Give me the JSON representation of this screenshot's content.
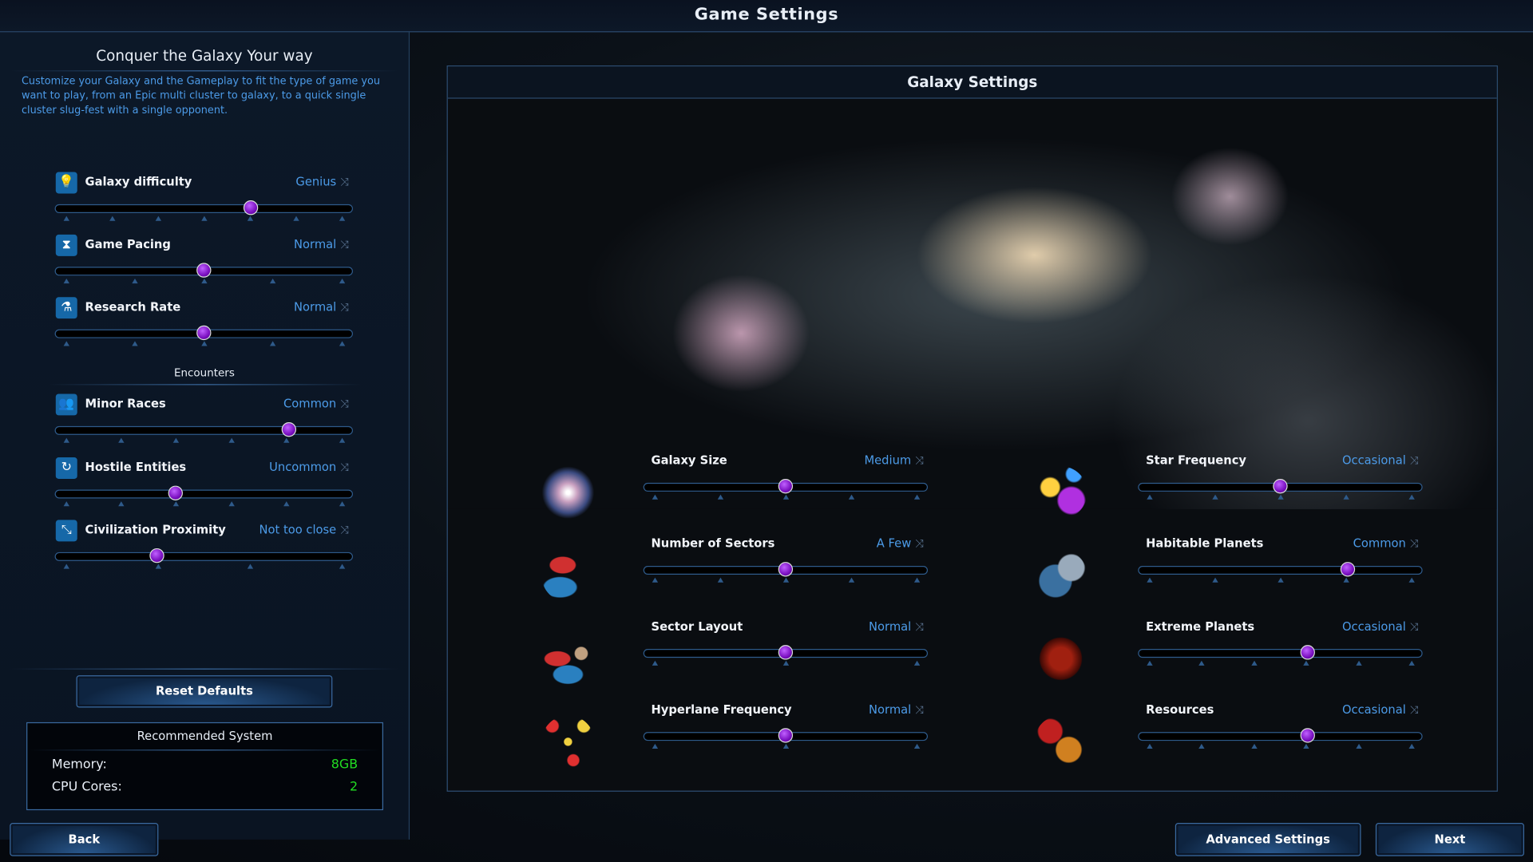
{
  "window_title": "Game Settings",
  "left_panel": {
    "heading": "Conquer the Galaxy Your way",
    "description": "Customize your Galaxy and the Gameplay to fit the type of game you want to play, from an Epic multi cluster to galaxy, to a quick single cluster slug-fest with a single opponent.",
    "encounters_heading": "Encounters",
    "settings": [
      {
        "label": "Galaxy difficulty",
        "value": "Genius",
        "icon": "lightbulb-icon",
        "positions": 7,
        "index": 4
      },
      {
        "label": "Game Pacing",
        "value": "Normal",
        "icon": "hourglass-icon",
        "positions": 5,
        "index": 2
      },
      {
        "label": "Research Rate",
        "value": "Normal",
        "icon": "flask-icon",
        "positions": 5,
        "index": 2
      },
      {
        "label": "Minor Races",
        "value": "Common",
        "icon": "people-icon",
        "positions": 6,
        "index": 4
      },
      {
        "label": "Hostile Entities",
        "value": "Uncommon",
        "icon": "creature-icon",
        "positions": 6,
        "index": 2
      },
      {
        "label": "Civilization Proximity",
        "value": "Not too close",
        "icon": "proximity-icon",
        "positions": 4,
        "index": 1
      }
    ],
    "reset_label": "Reset Defaults",
    "recommended": {
      "heading": "Recommended System",
      "memory_label": "Memory:",
      "memory_value": "8GB",
      "cpu_label": "CPU Cores:",
      "cpu_value": "2"
    }
  },
  "galaxy_settings": {
    "heading": "Galaxy Settings",
    "left_column": [
      {
        "label": "Galaxy Size",
        "value": "Medium",
        "icon": "spiral-galaxy-icon",
        "positions": 5,
        "index": 2
      },
      {
        "label": "Number of Sectors",
        "value": "A Few",
        "icon": "sectors-icon",
        "positions": 5,
        "index": 2
      },
      {
        "label": "Sector Layout",
        "value": "Normal",
        "icon": "sector-layout-icon",
        "positions": 3,
        "index": 1
      },
      {
        "label": "Hyperlane Frequency",
        "value": "Normal",
        "icon": "hyperlane-icon",
        "positions": 3,
        "index": 1
      }
    ],
    "right_column": [
      {
        "label": "Star Frequency",
        "value": "Occasional",
        "icon": "stars-icon",
        "positions": 5,
        "index": 2
      },
      {
        "label": "Habitable Planets",
        "value": "Common",
        "icon": "planets-icon",
        "positions": 5,
        "index": 3
      },
      {
        "label": "Extreme Planets",
        "value": "Occasional",
        "icon": "extreme-planet-icon",
        "positions": 6,
        "index": 3
      },
      {
        "label": "Resources",
        "value": "Occasional",
        "icon": "resources-icon",
        "positions": 6,
        "index": 3
      }
    ]
  },
  "footer": {
    "back_label": "Back",
    "advanced_label": "Advanced Settings",
    "next_label": "Next"
  },
  "colors": {
    "accent": "#4c9be8",
    "thumb": "#8a1fd0",
    "good": "#22dd22"
  },
  "shuffle_glyph": "⤨"
}
